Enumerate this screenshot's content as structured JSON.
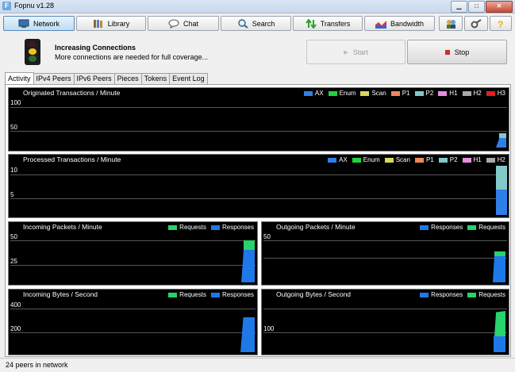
{
  "window": {
    "title": "Fopnu v1.28",
    "icon_letter": "F"
  },
  "toolbar": {
    "network": "Network",
    "library": "Library",
    "chat": "Chat",
    "search": "Search",
    "transfers": "Transfers",
    "bandwidth": "Bandwidth"
  },
  "status": {
    "title": "Increasing Connections",
    "subtitle": "More connections are needed for full coverage...",
    "start": "Start",
    "stop": "Stop"
  },
  "tabs": [
    "Activity",
    "IPv4 Peers",
    "IPv6 Peers",
    "Pieces",
    "Tokens",
    "Event Log"
  ],
  "legend_colors": {
    "AX": "#2f7fe8",
    "Enum": "#22d43b",
    "Scan": "#d9d75a",
    "P1": "#f0895a",
    "P2": "#84c8c8",
    "H1": "#e58ee0",
    "H2": "#a8a8a8",
    "H3": "#e01f1f",
    "Requests": "#27d36a",
    "Responses": "#1f78e8"
  },
  "charts": {
    "originated": {
      "title": "Originated Transactions / Minute",
      "legend": [
        "AX",
        "Enum",
        "Scan",
        "P1",
        "P2",
        "H1",
        "H2",
        "H3"
      ],
      "ticks": [
        "100",
        "50"
      ]
    },
    "processed": {
      "title": "Processed Transactions / Minute",
      "legend": [
        "AX",
        "Enum",
        "Scan",
        "P1",
        "P2",
        "H1",
        "H2"
      ],
      "ticks": [
        "10",
        "5"
      ]
    },
    "incoming_packets": {
      "title": "Incoming Packets / Minute",
      "legend": [
        "Requests",
        "Responses"
      ],
      "ticks": [
        "50",
        "25"
      ]
    },
    "outgoing_packets": {
      "title": "Outgoing Packets / Minute",
      "legend": [
        "Responses",
        "Requests"
      ],
      "ticks": [
        "50"
      ]
    },
    "incoming_bytes": {
      "title": "Incoming Bytes / Second",
      "legend": [
        "Requests",
        "Responses"
      ],
      "ticks": [
        "400",
        "200"
      ]
    },
    "outgoing_bytes": {
      "title": "Outgoing Bytes / Second",
      "legend": [
        "Responses",
        "Requests"
      ],
      "ticks": [
        "100"
      ]
    }
  },
  "statusbar": {
    "text": "24 peers in network"
  }
}
